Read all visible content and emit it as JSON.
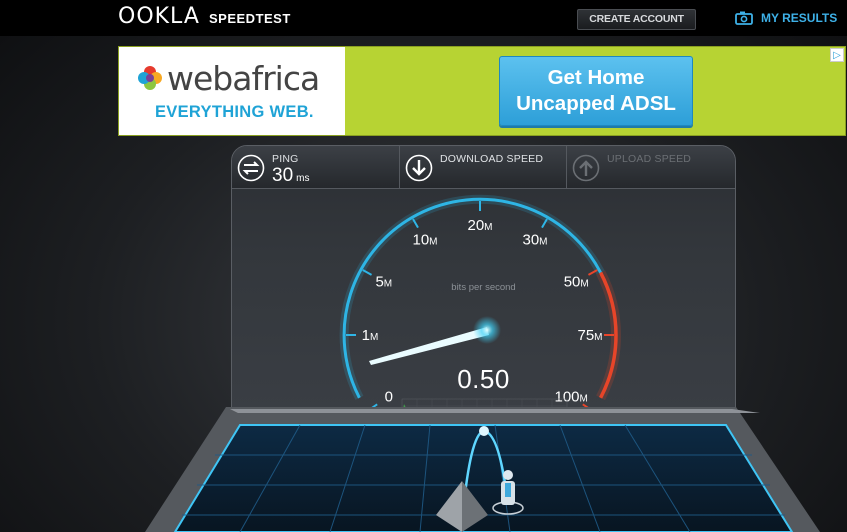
{
  "header": {
    "logo": "OOKLA",
    "product": "SPEEDTEST",
    "create_account": "CREATE ACCOUNT",
    "my_results": "MY RESULTS"
  },
  "ad": {
    "brand": "webafrica",
    "tagline": "EVERYTHING WEB.",
    "cta_line1": "Get Home",
    "cta_line2": "Uncapped ADSL"
  },
  "stats": {
    "ping": {
      "label": "PING",
      "value": "30",
      "unit": "ms"
    },
    "download": {
      "label": "DOWNLOAD SPEED"
    },
    "upload": {
      "label": "UPLOAD SPEED"
    }
  },
  "gauge": {
    "unit_label": "bits per second",
    "reading": "0.50",
    "ticks": [
      {
        "num": "0",
        "suffix": ""
      },
      {
        "num": "1",
        "suffix": "M"
      },
      {
        "num": "5",
        "suffix": "M"
      },
      {
        "num": "10",
        "suffix": "M"
      },
      {
        "num": "20",
        "suffix": "M"
      },
      {
        "num": "30",
        "suffix": "M"
      },
      {
        "num": "50",
        "suffix": "M"
      },
      {
        "num": "75",
        "suffix": "M"
      },
      {
        "num": "100",
        "suffix": "M"
      }
    ]
  },
  "colors": {
    "accent": "#3eb1e8",
    "gauge_blue": "#2fb5e6",
    "gauge_red": "#e8452a",
    "ad_green": "#b7d333"
  }
}
